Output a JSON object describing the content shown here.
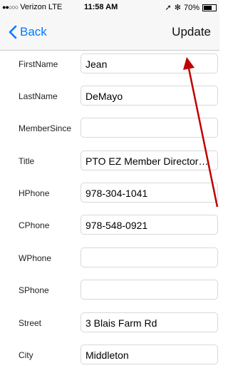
{
  "status_bar": {
    "signal_dots": "●●○○○",
    "carrier": "Verizon",
    "network": "LTE",
    "time": "11:58 AM",
    "battery": "70%",
    "battery_level": 0.7
  },
  "nav": {
    "back_label": "Back",
    "update_label": "Update"
  },
  "fields": [
    {
      "label": "FirstName",
      "value": "Jean"
    },
    {
      "label": "LastName",
      "value": "DeMayo"
    },
    {
      "label": "MemberSince",
      "value": ""
    },
    {
      "label": "Title",
      "value": "PTO EZ Member Directory…"
    },
    {
      "label": "HPhone",
      "value": "978-304-1041"
    },
    {
      "label": "CPhone",
      "value": "978-548-0921"
    },
    {
      "label": "WPhone",
      "value": ""
    },
    {
      "label": "SPhone",
      "value": ""
    },
    {
      "label": "Street",
      "value": "3 Blais Farm Rd"
    },
    {
      "label": "City",
      "value": "Middleton"
    }
  ],
  "colors": {
    "accent": "#007aff",
    "annotation_arrow": "#c00000"
  }
}
